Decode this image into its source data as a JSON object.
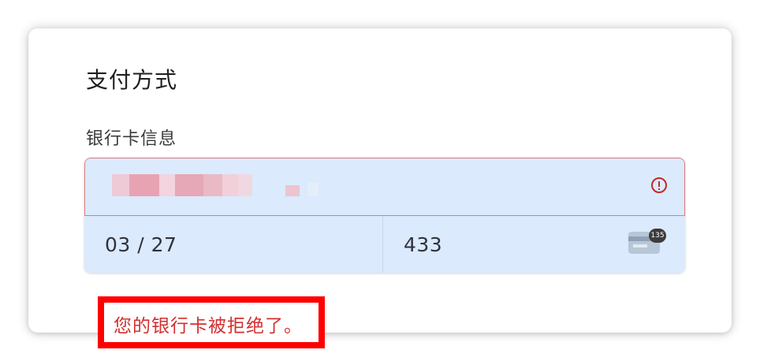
{
  "payment": {
    "title": "支付方式",
    "card_section_label": "银行卡信息",
    "card_number": {
      "value": "",
      "state": "error",
      "icon": "error-circle-icon"
    },
    "expiry": "03 / 27",
    "cvc": "433",
    "cvc_icon": "card-back-cvc-icon",
    "cvc_badge": "135",
    "error_message": "您的银行卡被拒绝了。"
  },
  "colors": {
    "field_bg": "#dbeafd",
    "error": "#d32f2f",
    "error_border": "#e07a7a",
    "highlight_box": "#ff0000"
  }
}
